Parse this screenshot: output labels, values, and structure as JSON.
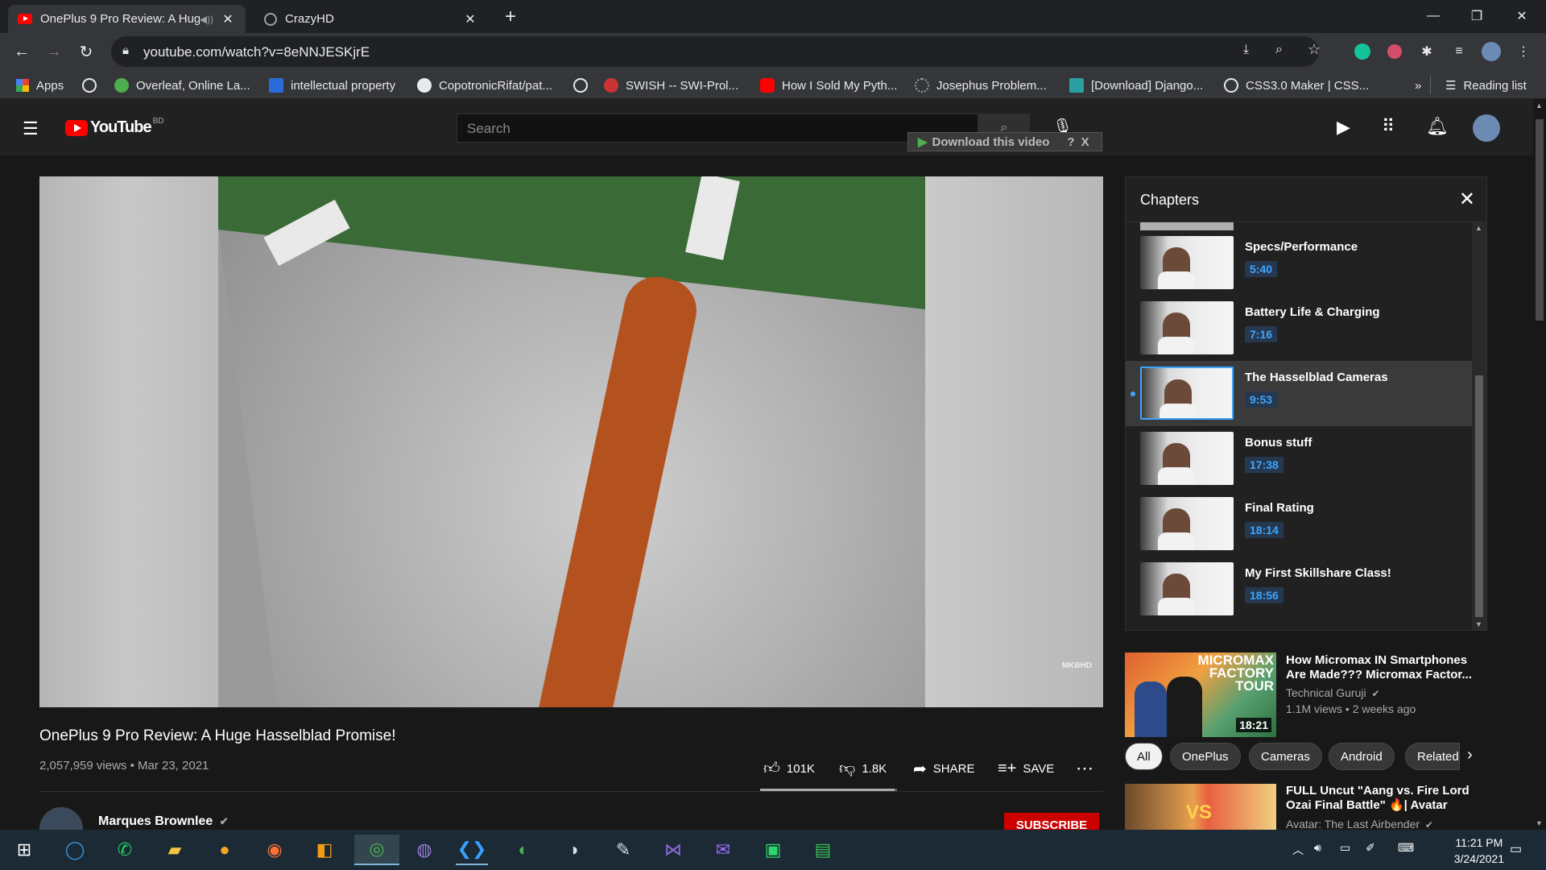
{
  "browser": {
    "tabs": [
      {
        "title": "OnePlus 9 Pro Review: A Hug",
        "active": true
      },
      {
        "title": "CrazyHD",
        "active": false
      }
    ],
    "new_tab": "+",
    "url": "youtube.com/watch?v=8eNNJESKjrE",
    "bookmarks": [
      "Apps",
      "Overleaf, Online La...",
      "intellectual property",
      "CopotronicRifat/pat...",
      "SWISH -- SWI-Prol...",
      "How I Sold My Pyth...",
      "Josephus Problem...",
      "[Download] Django...",
      "CSS3.0 Maker | CSS..."
    ],
    "more_bookmarks": "»",
    "reading_list": "Reading list"
  },
  "youtube": {
    "logo": "YouTube",
    "region": "BD",
    "search_placeholder": "Search",
    "download_bar": "Download this video",
    "download_help": "?",
    "download_close": "X"
  },
  "video": {
    "title": "OnePlus 9 Pro Review: A Huge Hasselblad Promise!",
    "meta": "2,057,959 views • Mar 23, 2021",
    "watermark": "MKBHD",
    "likes": "101K",
    "dislikes": "1.8K",
    "share": "SHARE",
    "save": "SAVE",
    "like_ratio": 0.98
  },
  "channel": {
    "name": "Marques Brownlee",
    "subscribe": "SUBSCRIBE"
  },
  "chapters": {
    "title": "Chapters",
    "items": [
      {
        "name": "Specs/Performance",
        "time": "5:40",
        "active": false
      },
      {
        "name": "Battery Life & Charging",
        "time": "7:16",
        "active": false
      },
      {
        "name": "The Hasselblad Cameras",
        "time": "9:53",
        "active": true
      },
      {
        "name": "Bonus stuff",
        "time": "17:38",
        "active": false
      },
      {
        "name": "Final Rating",
        "time": "18:14",
        "active": false
      },
      {
        "name": "My First Skillshare Class!",
        "time": "18:56",
        "active": false
      }
    ]
  },
  "recommendations": [
    {
      "title_line1": "How Micromax IN Smartphones",
      "title_line2": "Are Made??? Micromax Factor...",
      "channel": "Technical Guruji",
      "stats": "1.1M views • 2 weeks ago",
      "duration": "18:21",
      "thumb_text": "MICROMAX FACTORY TOUR"
    },
    {
      "title_line1": "FULL Uncut \"Aang vs. Fire Lord",
      "title_line2": "Ozai Final Battle\" 🔥| Avatar",
      "channel": "Avatar: The Last Airbender",
      "stats": "",
      "duration": "",
      "thumb_text": "VS"
    }
  ],
  "chips": [
    "All",
    "OnePlus",
    "Cameras",
    "Android",
    "Related"
  ],
  "taskbar": {
    "time": "11:21 PM",
    "date": "3/24/2021"
  },
  "colors": {
    "accent_blue": "#3ea6ff",
    "subscribe_red": "#cc0000",
    "yt_red": "#ff0000",
    "background": "#181818"
  }
}
